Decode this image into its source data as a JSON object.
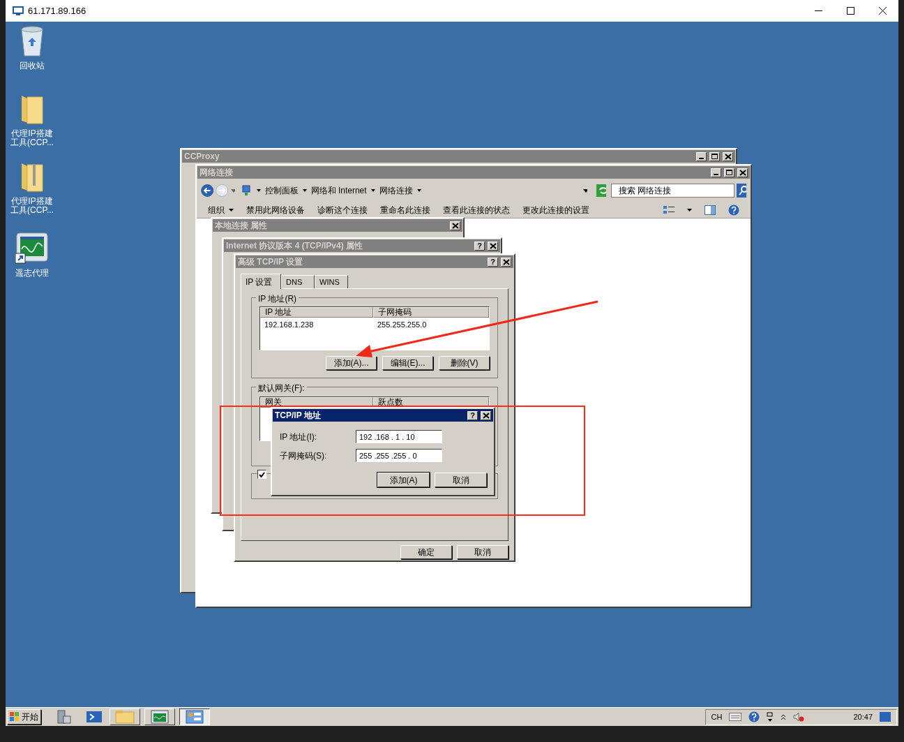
{
  "remote_window": {
    "title": "61.171.89.166"
  },
  "desktop_icons": [
    {
      "label": "回收站",
      "kind": "recycle"
    },
    {
      "label": "代理IP搭建工具(CCP...",
      "kind": "folder"
    },
    {
      "label": "代理IP搭建工具(CCP...",
      "kind": "zip"
    },
    {
      "label": "遥志代理",
      "kind": "shortcut"
    }
  ],
  "ccproxy_window": {
    "title": "CCProxy",
    "active": false
  },
  "network_window": {
    "title": "网络连接",
    "active": false,
    "breadcrumb": [
      "控制面板",
      "网络和 Internet",
      "网络连接"
    ],
    "search": {
      "placeholder": "搜索 网络连接"
    },
    "toolbar": [
      "组织",
      "禁用此网络设备",
      "诊断这个连接",
      "重命名此连接",
      "查看此连接的状态",
      "更改此连接的设置"
    ]
  },
  "properties_window": {
    "title": "本地连接 属性",
    "active": false
  },
  "ipv4_window": {
    "title": "Internet 协议版本 4 (TCP/IPv4) 属性",
    "active": false,
    "help_button": "?"
  },
  "advanced_window": {
    "title": "高级 TCP/IP 设置",
    "active": false,
    "help_button": "?",
    "tabs": [
      {
        "label": "IP 设置",
        "selected": true
      },
      {
        "label": "DNS",
        "selected": false
      },
      {
        "label": "WINS",
        "selected": false
      }
    ],
    "ip_group": {
      "label": "IP 地址(R)",
      "columns": [
        "IP 地址",
        "子网掩码"
      ],
      "rows": [
        [
          "192.168.1.238",
          "255.255.255.0"
        ]
      ],
      "buttons": [
        "添加(A)...",
        "编辑(E)...",
        "删除(V)"
      ]
    },
    "gateway_group": {
      "label": "默认网关(F):",
      "columns": [
        "网关",
        "跃点数"
      ]
    },
    "auto_metric": {
      "checked": true
    },
    "buttons": [
      "确定",
      "取消"
    ]
  },
  "address_dialog": {
    "title": "TCP/IP 地址",
    "active": true,
    "help_button": "?",
    "fields": [
      {
        "label": "IP 地址(I):",
        "value": "192 .168 . 1 . 10"
      },
      {
        "label": "子网掩码(S):",
        "value": "255 .255 .255 . 0"
      }
    ],
    "buttons": [
      "添加(A)",
      "取消"
    ]
  },
  "taskbar": {
    "start": "开始",
    "language": "CH",
    "clock": "20:47"
  }
}
